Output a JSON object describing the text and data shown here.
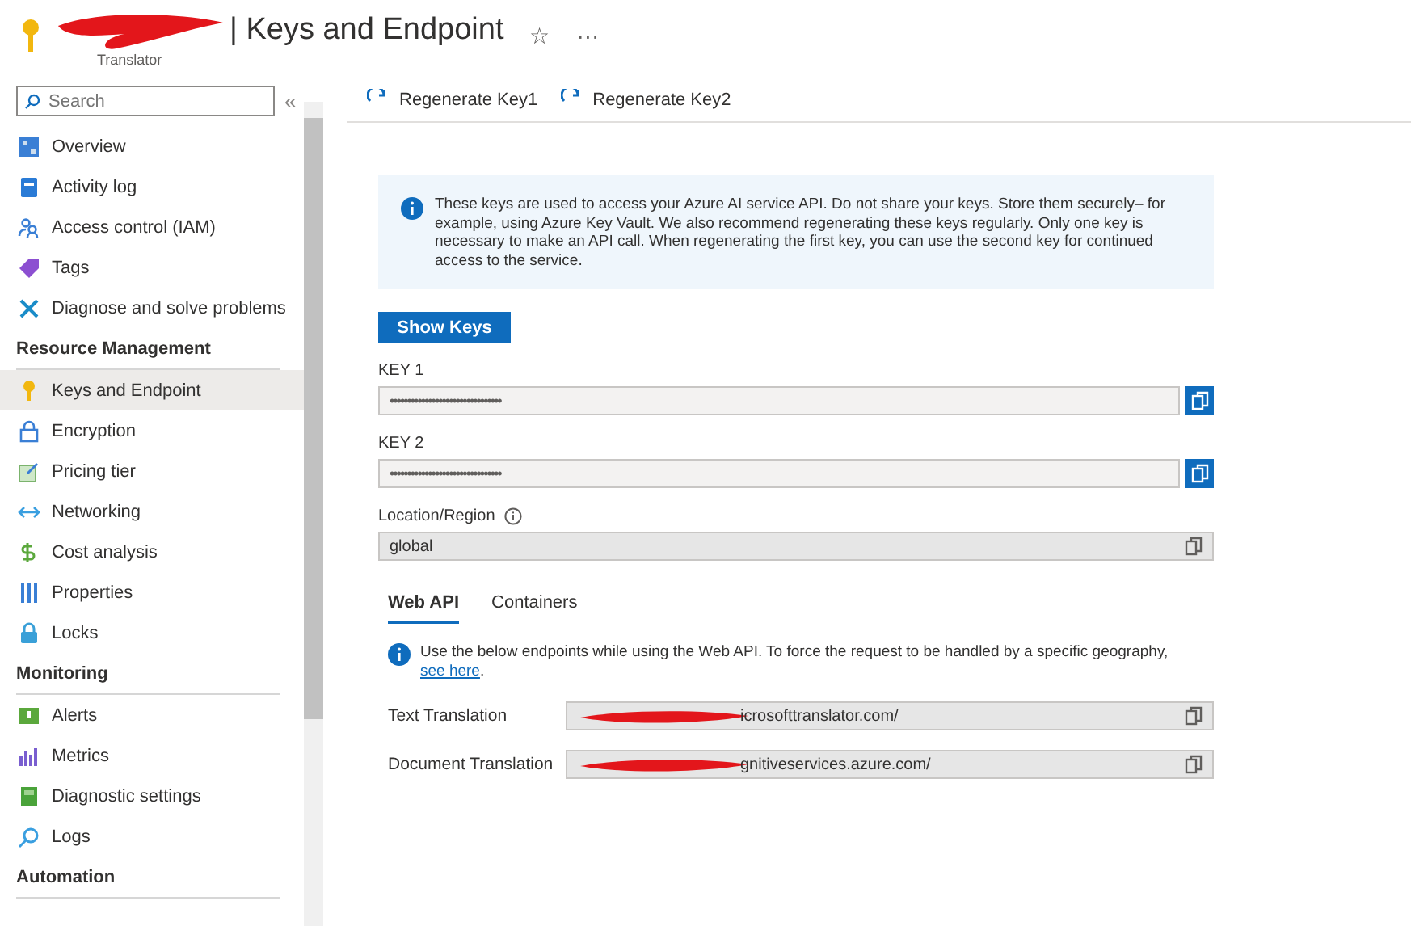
{
  "header": {
    "title": "| Keys and Endpoint",
    "subtitle": "Translator",
    "favorite": "☆",
    "more": "···"
  },
  "sidebar": {
    "search": {
      "placeholder": "Search"
    },
    "collapse": "«",
    "sections": [
      {
        "items": [
          {
            "label": "Overview",
            "selected": false
          },
          {
            "label": "Activity log",
            "selected": false
          },
          {
            "label": "Access control (IAM)",
            "selected": false
          },
          {
            "label": "Tags",
            "selected": false
          },
          {
            "label": "Diagnose and solve problems",
            "selected": false
          }
        ]
      },
      {
        "title": "Resource Management",
        "items": [
          {
            "label": "Keys and Endpoint",
            "selected": true
          },
          {
            "label": "Encryption",
            "selected": false
          },
          {
            "label": "Pricing tier",
            "selected": false
          },
          {
            "label": "Networking",
            "selected": false
          },
          {
            "label": "Cost analysis",
            "selected": false
          },
          {
            "label": "Properties",
            "selected": false
          },
          {
            "label": "Locks",
            "selected": false
          }
        ]
      },
      {
        "title": "Monitoring",
        "items": [
          {
            "label": "Alerts",
            "selected": false
          },
          {
            "label": "Metrics",
            "selected": false
          },
          {
            "label": "Diagnostic settings",
            "selected": false
          },
          {
            "label": "Logs",
            "selected": false
          }
        ]
      },
      {
        "title": "Automation"
      }
    ]
  },
  "toolbar": [
    {
      "label": "Regenerate Key1"
    },
    {
      "label": "Regenerate Key2"
    }
  ],
  "info": "These keys are used to access your Azure AI service API. Do not share your keys. Store them securely– for example, using Azure Key Vault. We also recommend regenerating these keys regularly. Only one key is necessary to make an API call. When regenerating the first key, you can use the second key for continued access to the service.",
  "show_keys": "Show Keys",
  "keys": [
    {
      "label": "KEY 1",
      "value": "••••••••••••••••••••••••••••••••"
    },
    {
      "label": "KEY 2",
      "value": "••••••••••••••••••••••••••••••••"
    }
  ],
  "location": {
    "label": "Location/Region",
    "value": "global"
  },
  "tabs": [
    {
      "label": "Web API",
      "selected": true
    },
    {
      "label": "Containers",
      "selected": false
    }
  ],
  "endpoint_info": {
    "text": "Use the below endpoints while using the Web API. To force the request to be handled by a specific geography,",
    "link": "see here",
    "end": "."
  },
  "endpoints": [
    {
      "label": "Text Translation",
      "value": "icrosofttranslator.com/"
    },
    {
      "label": "Document Translation",
      "value": "gnitiveservices.azure.com/"
    }
  ]
}
